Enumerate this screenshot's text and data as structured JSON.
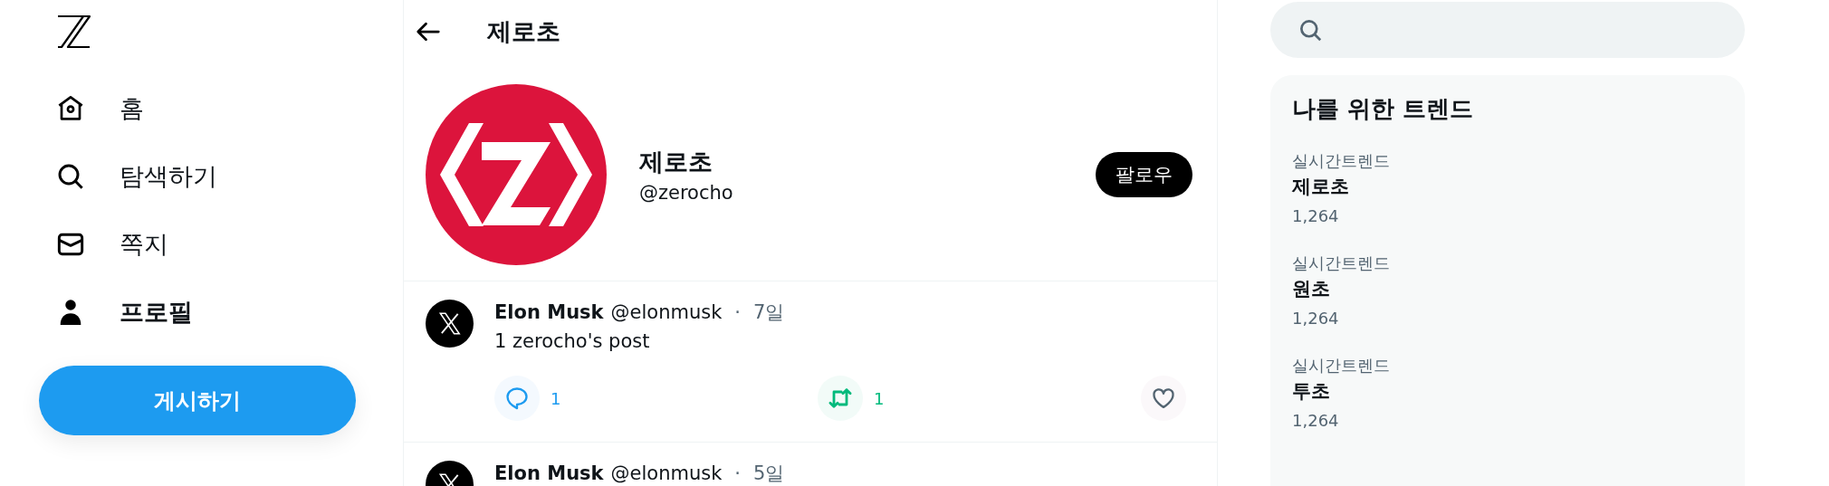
{
  "nav": {
    "items": [
      {
        "kind": "home",
        "label": "홈",
        "selected": false
      },
      {
        "kind": "search",
        "label": "탐색하기",
        "selected": false
      },
      {
        "kind": "mail",
        "label": "쪽지",
        "selected": false
      },
      {
        "kind": "person",
        "label": "프로필",
        "selected": true
      }
    ],
    "post_button": "게시하기"
  },
  "header": {
    "title": "제로초"
  },
  "profile": {
    "name": "제로초",
    "handle": "@zerocho",
    "follow_button": "팔로우"
  },
  "posts": [
    {
      "author": "Elon Musk",
      "handle": "@elonmusk",
      "separator": "·",
      "time": "7일",
      "text": "1 zerocho's post",
      "actions": [
        {
          "kind": "comment",
          "count": "1",
          "active": true
        },
        {
          "kind": "repost",
          "count": "1",
          "active": true
        },
        {
          "kind": "like",
          "active": false
        }
      ]
    },
    {
      "author": "Elon Musk",
      "handle": "@elonmusk",
      "separator": "·",
      "time": "5일"
    }
  ],
  "trends": {
    "title": "나를 위한 트렌드",
    "items": [
      {
        "category": "실시간트렌드",
        "name": "제로초",
        "count": "1,264"
      },
      {
        "category": "실시간트렌드",
        "name": "원초",
        "count": "1,264"
      },
      {
        "category": "실시간트렌드",
        "name": "투초",
        "count": "1,264"
      }
    ]
  }
}
